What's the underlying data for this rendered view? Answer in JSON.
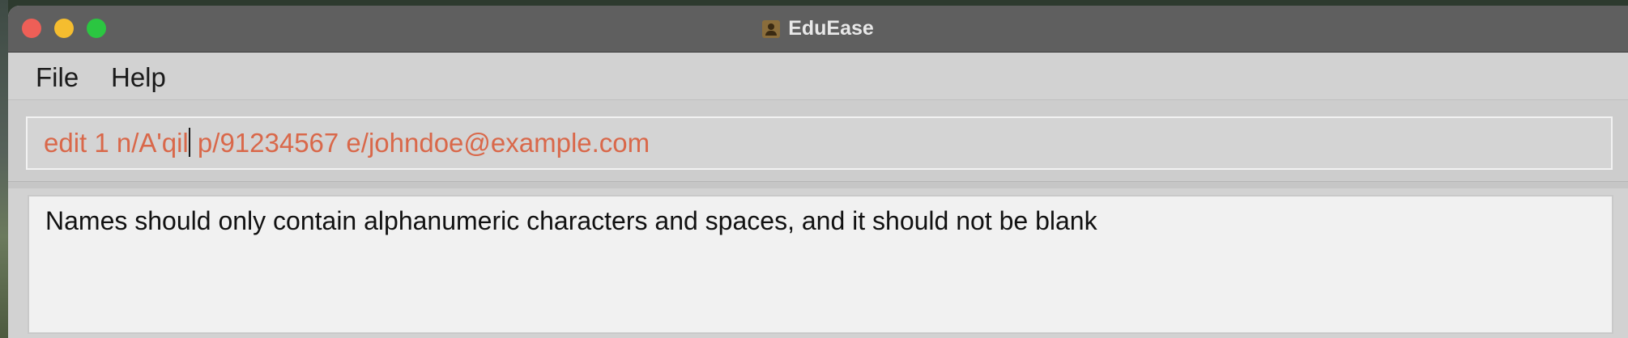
{
  "window": {
    "title": "EduEase",
    "app_icon": "contact-book-icon"
  },
  "menu": {
    "items": [
      {
        "label": "File"
      },
      {
        "label": "Help"
      }
    ]
  },
  "command_box": {
    "value_before_caret": "edit 1 n/A'qil",
    "value_after_caret": " p/91234567 e/johndoe@example.com"
  },
  "result_display": {
    "message": "Names should only contain alphanumeric characters and spaces, and it should not be blank"
  },
  "colors": {
    "command_text": "#d9684a",
    "titlebar": "#5f5f5f",
    "close": "#ee5f57",
    "minimize": "#f5bd2f",
    "zoom": "#2bc641"
  }
}
